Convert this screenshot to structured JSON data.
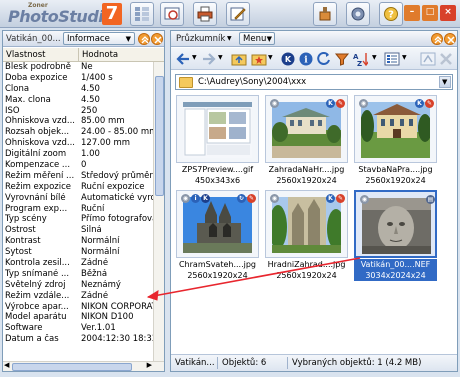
{
  "app": {
    "brand_top": "Zoner",
    "brand_name": "PhotoStudio",
    "brand_version": "7"
  },
  "toolbar": {
    "buttons": [
      "browser-icon",
      "viewer-icon",
      "printer-icon",
      "editor-icon"
    ],
    "right_buttons": [
      "tools-icon",
      "settings-icon",
      "help-icon"
    ],
    "window": [
      "minimize",
      "restore",
      "close"
    ]
  },
  "left_panel": {
    "title": "Vatikán_00...",
    "dropdown": "Informace",
    "col_key": "Vlastnost",
    "col_value": "Hodnota",
    "rows": [
      {
        "k": "Blesk podrobně",
        "v": "Ne"
      },
      {
        "k": "Doba expozice",
        "v": "1/400 s"
      },
      {
        "k": "Clona",
        "v": "4.50"
      },
      {
        "k": "Max. clona",
        "v": "4.50"
      },
      {
        "k": "ISO",
        "v": "250"
      },
      {
        "k": "Ohniskova vzd...",
        "v": "85.00 mm"
      },
      {
        "k": "Rozsah objek...",
        "v": "24.00 - 85.00 mm"
      },
      {
        "k": "Ohniskova vzd...",
        "v": "127.00 mm"
      },
      {
        "k": "Digitální zoom",
        "v": "1.00"
      },
      {
        "k": "Kompenzace ...",
        "v": "0"
      },
      {
        "k": "Režim měření ...",
        "v": "Středový průměr"
      },
      {
        "k": "Režim expozice",
        "v": "Ruční expozice"
      },
      {
        "k": "Vyrovnání bílé",
        "v": "Automatické vyrov"
      },
      {
        "k": "Program exp...",
        "v": "Ruční"
      },
      {
        "k": "Typ scény",
        "v": "Přímo fotografova"
      },
      {
        "k": "Ostrost",
        "v": "Silná"
      },
      {
        "k": "Kontrast",
        "v": "Normální"
      },
      {
        "k": "Sytost",
        "v": "Normální"
      },
      {
        "k": "Kontrola zesil...",
        "v": "Žádné"
      },
      {
        "k": "Typ snímané ...",
        "v": "Běžná"
      },
      {
        "k": "Světelný zdroj",
        "v": "Neznámý"
      },
      {
        "k": "Režim vzdále...",
        "v": "Žádné"
      },
      {
        "k": "Výrobce apar...",
        "v": "NIKON CORPORAT"
      },
      {
        "k": "Model aparátu",
        "v": "NIKON D100"
      },
      {
        "k": "Software",
        "v": "Ver.1.01"
      },
      {
        "k": "Datum a čas",
        "v": "2004:12:30 18:33"
      }
    ]
  },
  "right_panel": {
    "title": "Průzkumník",
    "menu": "Menu",
    "path": "C:\\Audrey\\Sony\\2004\\xxx",
    "thumbnails": [
      {
        "name": "ZPS7Preview....gif",
        "dims": "450x343x6"
      },
      {
        "name": "ZahradaNaHr....jpg",
        "dims": "2560x1920x24"
      },
      {
        "name": "StavbaNaPra....jpg",
        "dims": "2560x1920x24"
      },
      {
        "name": "ChramSvateh....jpg",
        "dims": "2560x1920x24"
      },
      {
        "name": "HradniZahrad....jpg",
        "dims": "2560x1920x24"
      },
      {
        "name": "Vatikán_00....NEF",
        "dims": "3034x2024x24"
      }
    ],
    "status": {
      "file": "Vatikán...",
      "count": "Objektů: 6",
      "selected": "Vybraných objektů: 1 (4.2 MB)"
    }
  },
  "colors": {
    "selection": "#316ac5",
    "arrow": "#e8262e",
    "brand_orange": "#f26522"
  }
}
